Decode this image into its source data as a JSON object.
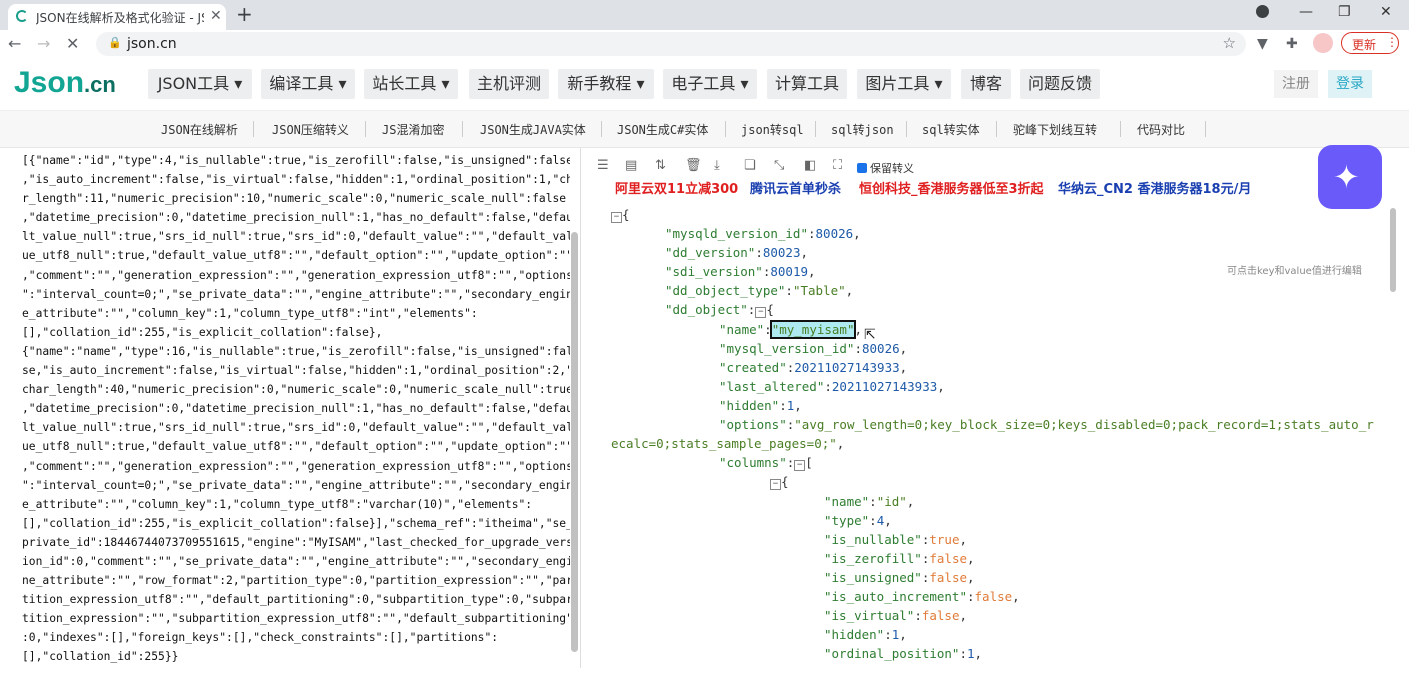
{
  "browser": {
    "tab_title": "JSON在线解析及格式化验证 - JS",
    "url": "json.cn",
    "update_label": "更新"
  },
  "site": {
    "logo_main": "Json",
    "logo_suffix": ".cn",
    "nav": [
      "JSON工具",
      "编译工具",
      "站长工具",
      "主机评测",
      "新手教程",
      "电子工具",
      "计算工具",
      "图片工具",
      "博客",
      "问题反馈"
    ],
    "signup": "注册",
    "login": "登录",
    "subnav": [
      "JSON在线解析",
      "JSON压缩转义",
      "JS混淆加密",
      "JSON生成JAVA实体",
      "JSON生成C#实体",
      "json转sql",
      "sql转json",
      "sql转实体",
      "驼峰下划线互转",
      "代码对比"
    ]
  },
  "left_text": [
    "[{\"name\":\"id\",\"type\":4,\"is_nullable\":true,\"is_zerofill\":false,\"is_unsigned\":false",
    ",\"is_auto_increment\":false,\"is_virtual\":false,\"hidden\":1,\"ordinal_position\":1,\"cha",
    "r_length\":11,\"numeric_precision\":10,\"numeric_scale\":0,\"numeric_scale_null\":false",
    ",\"datetime_precision\":0,\"datetime_precision_null\":1,\"has_no_default\":false,\"defau",
    "lt_value_null\":true,\"srs_id_null\":true,\"srs_id\":0,\"default_value\":\"\",\"default_val",
    "ue_utf8_null\":true,\"default_value_utf8\":\"\",\"default_option\":\"\",\"update_option\":\"\"",
    ",\"comment\":\"\",\"generation_expression\":\"\",\"generation_expression_utf8\":\"\",\"options",
    "\":\"interval_count=0;\",\"se_private_data\":\"\",\"engine_attribute\":\"\",\"secondary_engin",
    "e_attribute\":\"\",\"column_key\":1,\"column_type_utf8\":\"int\",\"elements\":",
    "[],\"collation_id\":255,\"is_explicit_collation\":false},",
    "{\"name\":\"name\",\"type\":16,\"is_nullable\":true,\"is_zerofill\":false,\"is_unsigned\":fal",
    "se,\"is_auto_increment\":false,\"is_virtual\":false,\"hidden\":1,\"ordinal_position\":2,\"",
    "char_length\":40,\"numeric_precision\":0,\"numeric_scale\":0,\"numeric_scale_null\":true",
    ",\"datetime_precision\":0,\"datetime_precision_null\":1,\"has_no_default\":false,\"defau",
    "lt_value_null\":true,\"srs_id_null\":true,\"srs_id\":0,\"default_value\":\"\",\"default_val",
    "ue_utf8_null\":true,\"default_value_utf8\":\"\",\"default_option\":\"\",\"update_option\":\"\"",
    ",\"comment\":\"\",\"generation_expression\":\"\",\"generation_expression_utf8\":\"\",\"options",
    "\":\"interval_count=0;\",\"se_private_data\":\"\",\"engine_attribute\":\"\",\"secondary_engin",
    "e_attribute\":\"\",\"column_key\":1,\"column_type_utf8\":\"varchar(10)\",\"elements\":",
    "[],\"collation_id\":255,\"is_explicit_collation\":false}],\"schema_ref\":\"itheima\",\"se_",
    "private_id\":18446744073709551615,\"engine\":\"MyISAM\",\"last_checked_for_upgrade_vers",
    "ion_id\":0,\"comment\":\"\",\"se_private_data\":\"\",\"engine_attribute\":\"\",\"secondary_engi",
    "ne_attribute\":\"\",\"row_format\":2,\"partition_type\":0,\"partition_expression\":\"\",\"par",
    "tition_expression_utf8\":\"\",\"default_partitioning\":0,\"subpartition_type\":0,\"subpar",
    "tition_expression\":\"\",\"subpartition_expression_utf8\":\"\",\"default_subpartitioning\"",
    ":0,\"indexes\":[],\"foreign_keys\":[],\"check_constraints\":[],\"partitions\":",
    "[],\"collation_id\":255}}"
  ],
  "toolbar": {
    "keep_escape_label": "保留转义"
  },
  "ads": [
    "阿里云双11立减300",
    "腾讯云首单秒杀",
    "恒创科技_香港服务器低至3折起",
    "华纳云_CN2 香港服务器18元/月"
  ],
  "hint": "可点击key和value值进行编辑",
  "tree": {
    "mysqld_version_id": "80026",
    "dd_version": "80023",
    "sdi_version": "80019",
    "dd_object_type": "\"Table\"",
    "name": "\"my_myisam\"",
    "mysql_version_id": "80026",
    "created": "20211027143933",
    "last_altered": "20211027143933",
    "hidden": "1",
    "options_line1": "\"avg_row_length=0;key_block_size=0;keys_disabled=0;pack_record=1;stats_auto_r",
    "options_line2": "ecalc=0;stats_sample_pages=0;\"",
    "col_name": "\"id\"",
    "col_type": "4",
    "col_is_nullable": "true",
    "col_is_zerofill": "false",
    "col_is_unsigned": "false",
    "col_is_auto_increment": "false",
    "col_is_virtual": "false",
    "col_hidden": "1",
    "col_ordinal_position": "1"
  }
}
